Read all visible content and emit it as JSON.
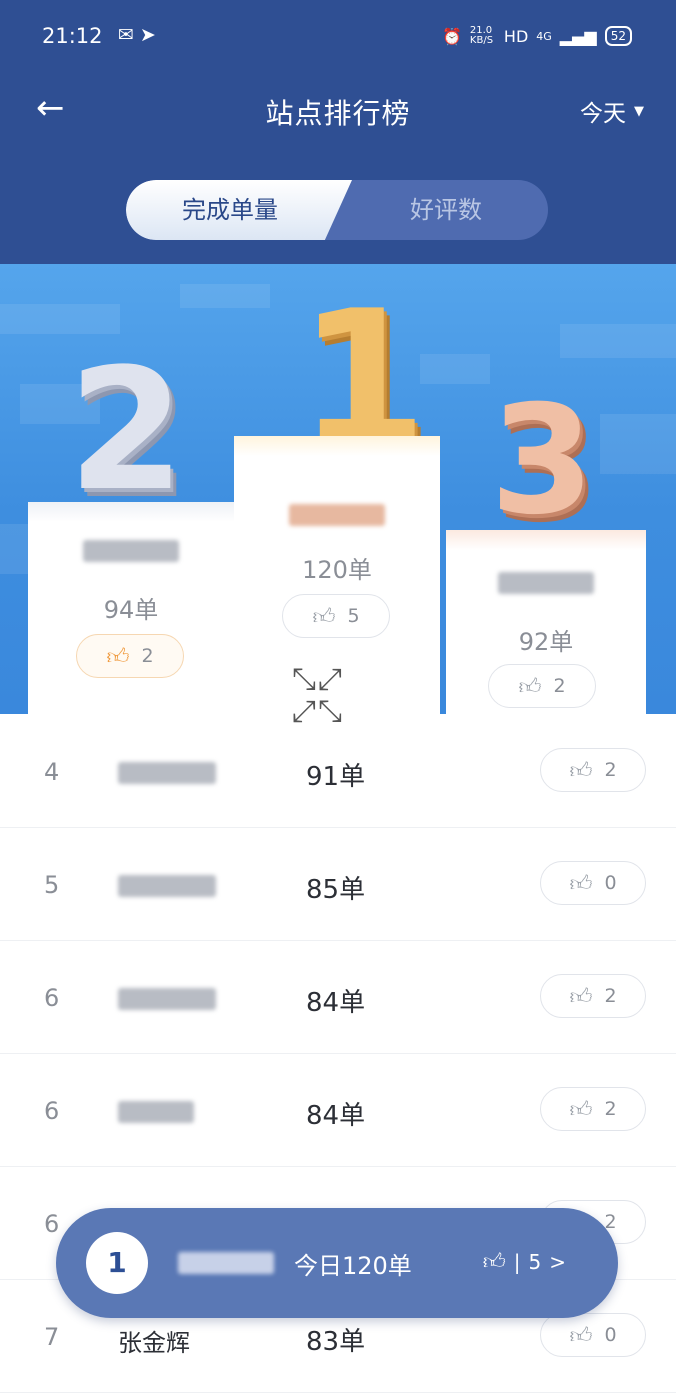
{
  "status_bar": {
    "time": "21:12",
    "left_icons": [
      "wechat-icon",
      "location-icon"
    ],
    "net_speed": "21.0 KB/S",
    "hd": "HD",
    "network": "4G",
    "battery": "52"
  },
  "header": {
    "back_icon": "arrow-left-icon",
    "title": "站点排行榜",
    "filter_label": "今天"
  },
  "tabs": [
    {
      "label": "完成单量",
      "active": true
    },
    {
      "label": "好评数",
      "active": false
    }
  ],
  "podium": [
    {
      "rank": "2",
      "count": "94单",
      "likes": "2",
      "liked": true
    },
    {
      "rank": "1",
      "count": "120单",
      "likes": "5",
      "liked": false
    },
    {
      "rank": "3",
      "count": "92单",
      "likes": "2",
      "liked": false
    }
  ],
  "ranking_list": [
    {
      "rank": "4",
      "count": "91单",
      "likes": "2"
    },
    {
      "rank": "5",
      "count": "85单",
      "likes": "0"
    },
    {
      "rank": "6",
      "count": "84单",
      "likes": "2"
    },
    {
      "rank": "6",
      "count": "84单",
      "likes": "2"
    },
    {
      "rank": "6",
      "count": "",
      "likes": "2"
    },
    {
      "rank": "7",
      "name": "张金辉",
      "count": "83单",
      "likes": "0"
    }
  ],
  "my_summary": {
    "rank": "1",
    "today": "今日120单",
    "likes": "5",
    "chevron": ">"
  },
  "colors": {
    "header_bg": "#2f4f93",
    "podium_bg": "#3e8edf",
    "gold": "#f1c06a",
    "silver": "#dfe3ee",
    "bronze": "#f0bfa5",
    "like_on": "#f09a3e"
  }
}
